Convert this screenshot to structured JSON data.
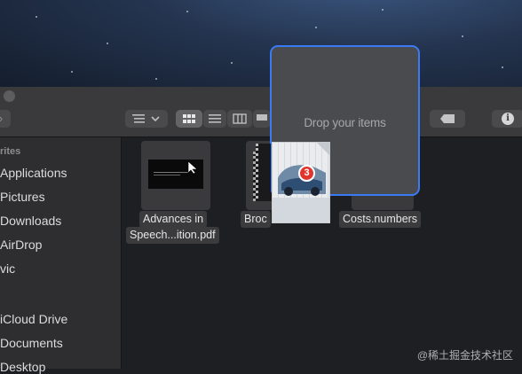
{
  "sidebar": {
    "section_header": "rites",
    "items": [
      {
        "label": "Applications"
      },
      {
        "label": "Pictures"
      },
      {
        "label": "Downloads"
      },
      {
        "label": "AirDrop"
      },
      {
        "label": "vic"
      },
      {
        "label": "iCloud Drive"
      },
      {
        "label": "Documents"
      },
      {
        "label": "Desktop"
      }
    ]
  },
  "toolbar": {
    "info_glyph": "i"
  },
  "files": [
    {
      "name_line1": "Advances in",
      "name_line2": "Speech...ition.pdf",
      "icon": "pdf-document-icon"
    },
    {
      "name_line1": "Broc",
      "icon": "brochure-icon"
    },
    {
      "name_line1": "Costs.numbers",
      "icon": "numbers-file-icon"
    }
  ],
  "drag": {
    "badge_count": "3",
    "drop_text": "Drop your items"
  },
  "colors": {
    "accent": "#3a7bf5",
    "badge": "#e0352c"
  },
  "watermark": "@稀土掘金技术社区"
}
